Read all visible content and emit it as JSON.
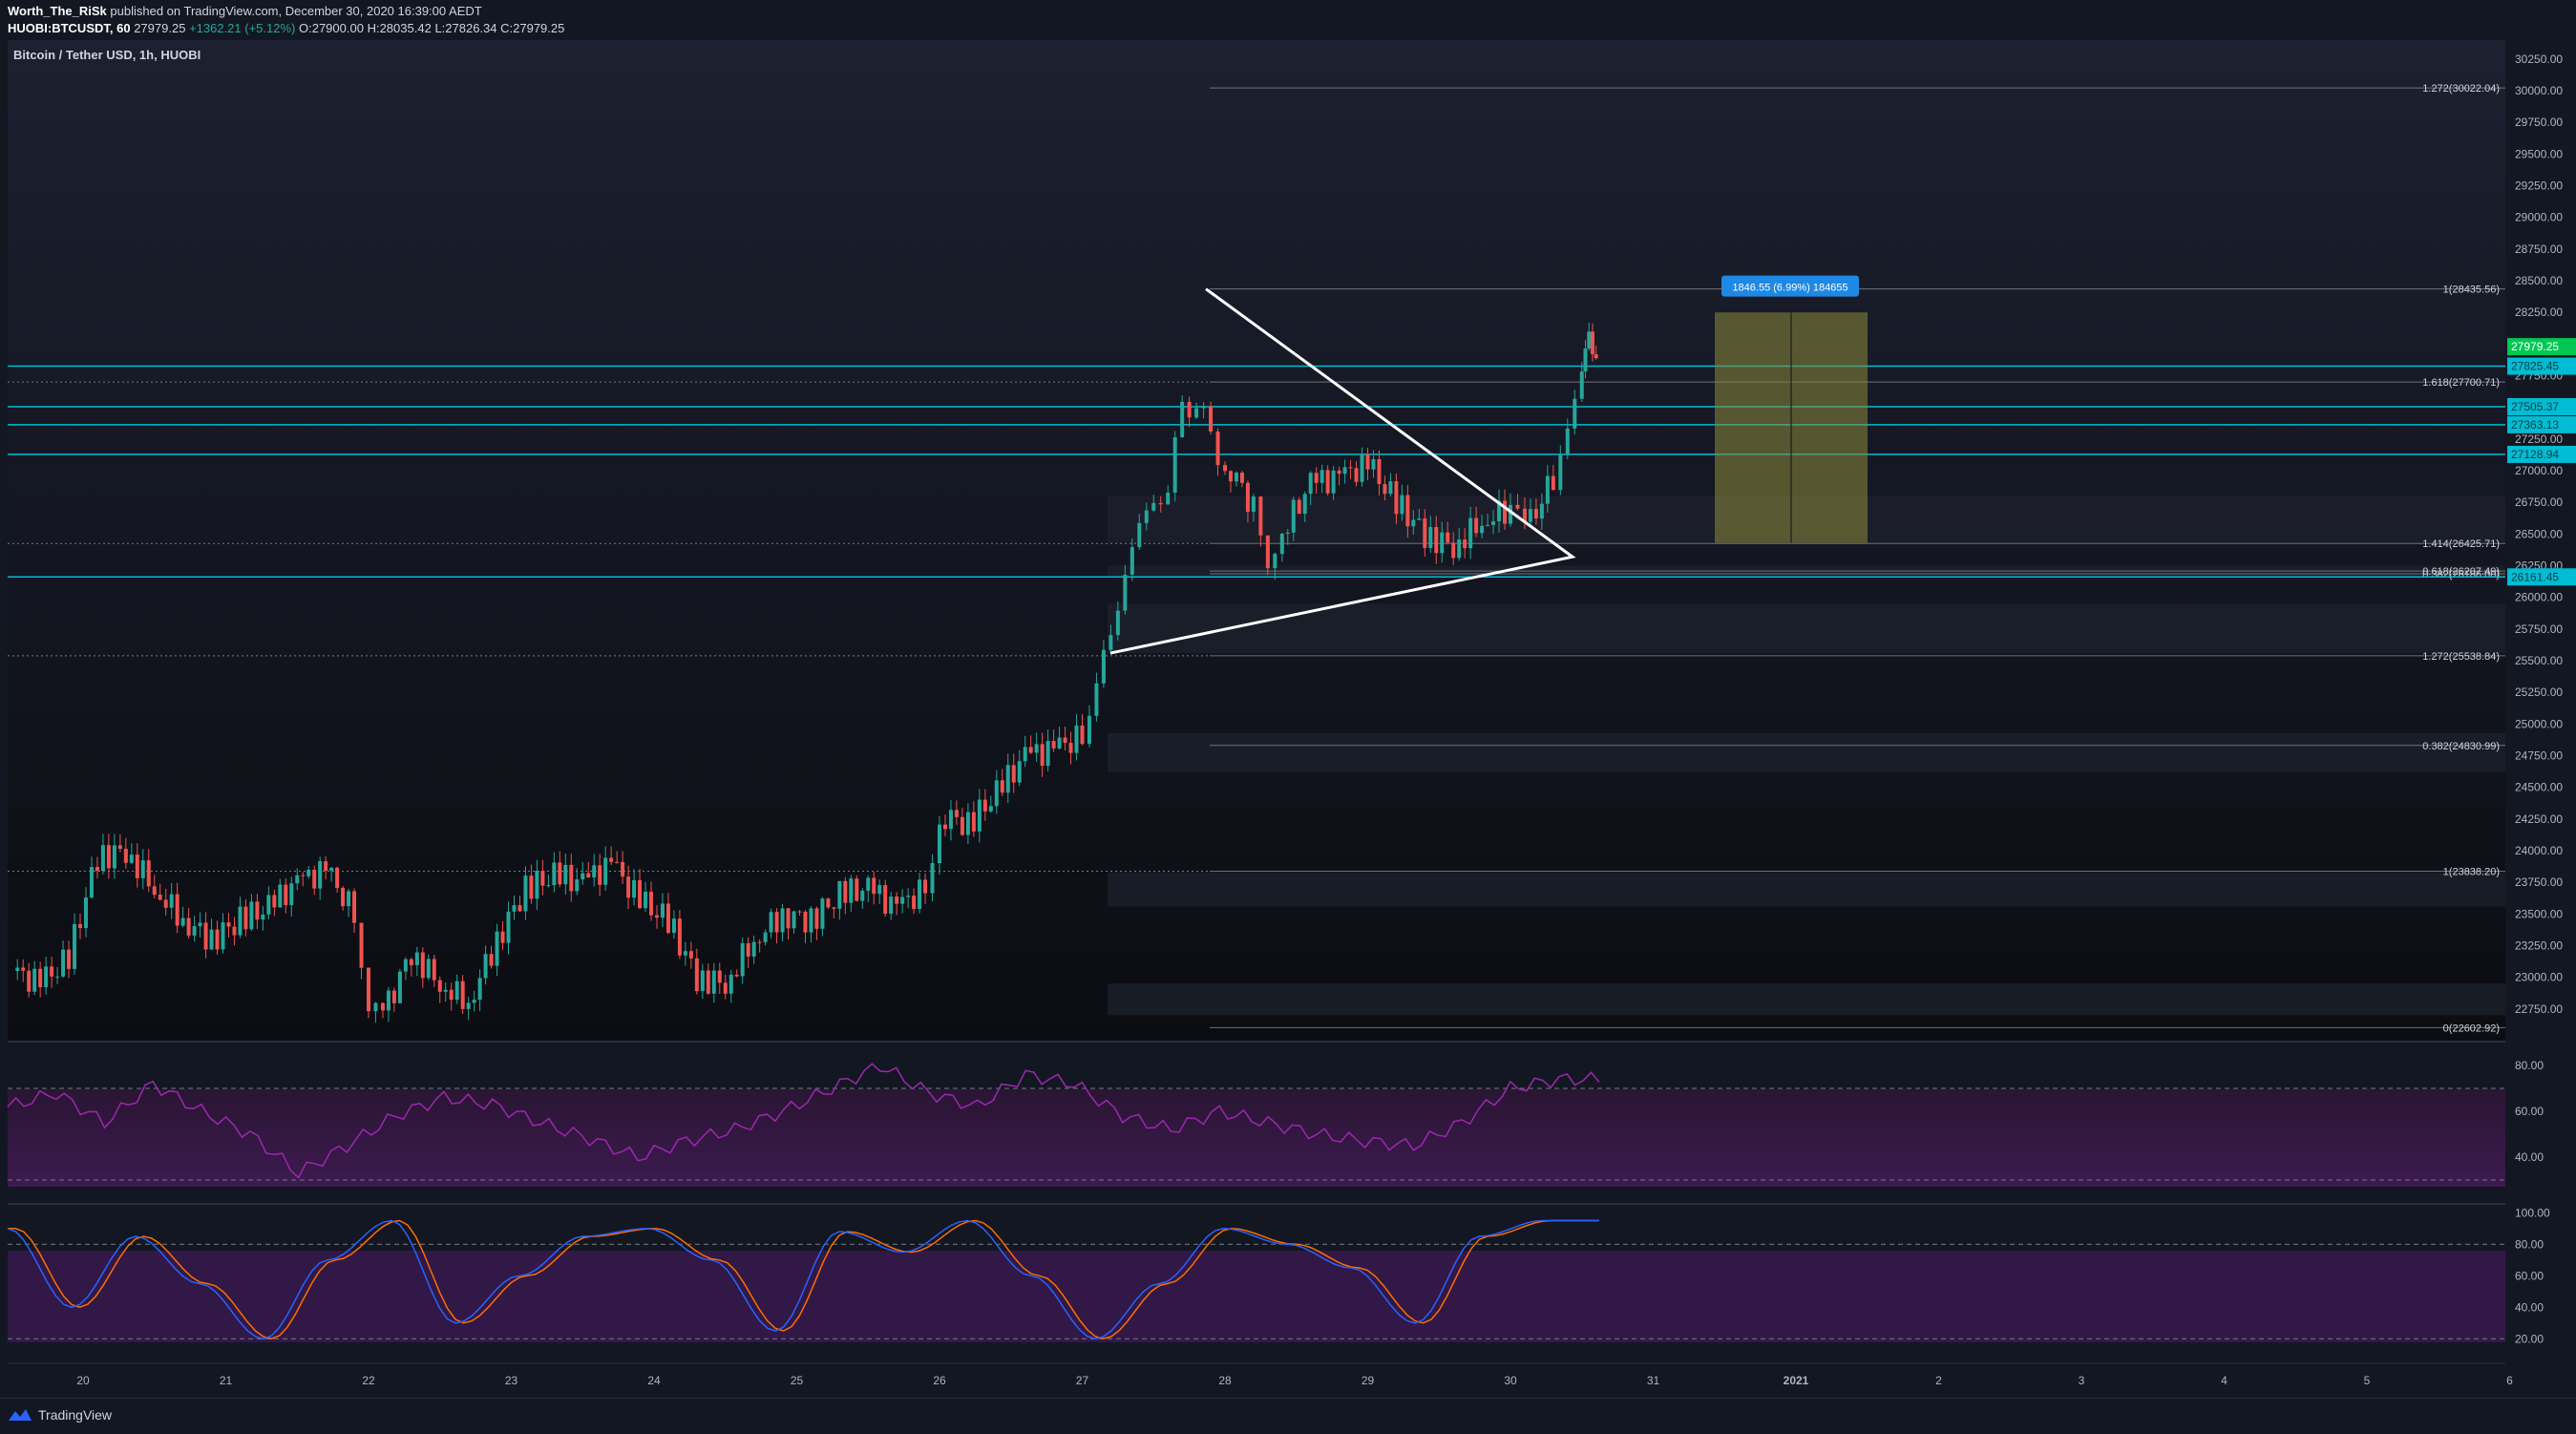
{
  "header": {
    "author": "Worth_The_RiSk",
    "published": "published on TradingView.com, December 30, 2020 16:39:00 AEDT",
    "symbol": "HUOBI:BTCUSDT, 60",
    "last": "27979.25",
    "change": "+1362.21 (+5.12%)",
    "ohlc_o": "O:27900.00",
    "ohlc_h": "H:28035.42",
    "ohlc_l": "L:27826.34",
    "ohlc_c": "C:27979.25"
  },
  "chart_title": "Bitcoin / Tether USD, 1h, HUOBI",
  "colors": {
    "background": "#131722",
    "bullish": "#26a69a",
    "bearish": "#ef5350",
    "cyan_level": "#00bcd4",
    "rsi_line": "#9c27b0",
    "stoch_k": "#2962ff",
    "stoch_d": "#ff6d00",
    "price_badge": "#1e88e5",
    "last_price": "#00c853"
  },
  "chart_data": {
    "type": "candlestick",
    "title": "Bitcoin / Tether USD, 1h, HUOBI",
    "ylim": [
      22500,
      30400
    ],
    "y_ticks": [
      "30250.00",
      "30000.00",
      "29750.00",
      "29500.00",
      "29250.00",
      "29000.00",
      "28750.00",
      "28500.00",
      "28250.00",
      "28000.00",
      "27750.00",
      "27500.00",
      "27250.00",
      "27000.00",
      "26750.00",
      "26500.00",
      "26250.00",
      "26000.00",
      "25750.00",
      "25500.00",
      "25250.00",
      "25000.00",
      "24750.00",
      "24500.00",
      "24250.00",
      "24000.00",
      "23750.00",
      "23500.00",
      "23250.00",
      "23000.00",
      "22750.00"
    ],
    "y_tick_values": [
      30250,
      30000,
      29750,
      29500,
      29250,
      29000,
      28750,
      28500,
      28250,
      28000,
      27750,
      27500,
      27250,
      27000,
      26750,
      26500,
      26250,
      26000,
      25750,
      25500,
      25250,
      25000,
      24750,
      24500,
      24250,
      24000,
      23750,
      23500,
      23250,
      23000,
      22750
    ],
    "x_ticks": [
      "20",
      "21",
      "22",
      "23",
      "24",
      "25",
      "26",
      "27",
      "28",
      "29",
      "30",
      "31",
      "2021",
      "2",
      "3",
      "4",
      "5",
      "6"
    ],
    "candles_close_path": [
      [
        19.5,
        23050
      ],
      [
        19.7,
        22950
      ],
      [
        19.9,
        23150
      ],
      [
        20.1,
        23950
      ],
      [
        20.3,
        24000
      ],
      [
        20.5,
        23700
      ],
      [
        20.7,
        23450
      ],
      [
        20.9,
        23300
      ],
      [
        21.1,
        23450
      ],
      [
        21.3,
        23550
      ],
      [
        21.5,
        23750
      ],
      [
        21.7,
        23850
      ],
      [
        21.9,
        23500
      ],
      [
        22.0,
        22800
      ],
      [
        22.1,
        22700
      ],
      [
        22.3,
        23200
      ],
      [
        22.5,
        22950
      ],
      [
        22.7,
        22800
      ],
      [
        22.9,
        23300
      ],
      [
        23.1,
        23700
      ],
      [
        23.3,
        23800
      ],
      [
        23.5,
        23750
      ],
      [
        23.7,
        23900
      ],
      [
        23.9,
        23600
      ],
      [
        24.1,
        23450
      ],
      [
        24.3,
        23000
      ],
      [
        24.5,
        22950
      ],
      [
        24.7,
        23300
      ],
      [
        24.9,
        23500
      ],
      [
        25.1,
        23450
      ],
      [
        25.3,
        23650
      ],
      [
        25.5,
        23700
      ],
      [
        25.7,
        23550
      ],
      [
        25.9,
        23700
      ],
      [
        26.0,
        24300
      ],
      [
        26.2,
        24200
      ],
      [
        26.4,
        24450
      ],
      [
        26.6,
        24750
      ],
      [
        26.8,
        24800
      ],
      [
        27.0,
        24900
      ],
      [
        27.1,
        25400
      ],
      [
        27.2,
        25650
      ],
      [
        27.3,
        26200
      ],
      [
        27.4,
        26600
      ],
      [
        27.5,
        26700
      ],
      [
        27.6,
        26900
      ],
      [
        27.7,
        27450
      ],
      [
        27.8,
        27600
      ],
      [
        27.9,
        27200
      ],
      [
        28.0,
        27100
      ],
      [
        28.2,
        26700
      ],
      [
        28.3,
        26200
      ],
      [
        28.4,
        26500
      ],
      [
        28.6,
        26900
      ],
      [
        28.8,
        26950
      ],
      [
        29.0,
        27050
      ],
      [
        29.2,
        26750
      ],
      [
        29.4,
        26500
      ],
      [
        29.6,
        26400
      ],
      [
        29.8,
        26600
      ],
      [
        30.0,
        26700
      ],
      [
        30.1,
        26500
      ],
      [
        30.3,
        26950
      ],
      [
        30.4,
        27350
      ],
      [
        30.5,
        27800
      ],
      [
        30.55,
        28050
      ],
      [
        30.6,
        27979
      ]
    ],
    "horizontal_levels": [
      {
        "price": 27825.45,
        "label": "27825.45"
      },
      {
        "price": 27505.37,
        "label": "27505.37"
      },
      {
        "price": 27363.13,
        "label": "27363.13"
      },
      {
        "price": 27128.94,
        "label": "27128.94"
      },
      {
        "price": 26161.45,
        "label": "26161.45"
      }
    ],
    "last_price": {
      "price": 27979.25,
      "label": "27979.25"
    },
    "fib_levels": [
      {
        "price": 30022.04,
        "label": "1.272(30022.04)"
      },
      {
        "price": 28435.56,
        "label": "1(28435.56)"
      },
      {
        "price": 27700.71,
        "label": "1.618(27700.71)"
      },
      {
        "price": 26425.71,
        "label": "1.414(26425.71)"
      },
      {
        "price": 26207.49,
        "label": "0.618(26207.49)"
      },
      {
        "price": 26186.0,
        "label": "0.382(26186.00)"
      },
      {
        "price": 25538.84,
        "label": "1.272(25538.84)"
      },
      {
        "price": 24830.99,
        "label": "0.382(24830.99)"
      },
      {
        "price": 23838.2,
        "label": "1(23838.20)"
      },
      {
        "price": 22602.92,
        "label": "0(22602.92)"
      }
    ],
    "measure_label": "1846.55 (6.99%) 184655",
    "rsi": {
      "ticks": [
        "80.00",
        "60.00",
        "40.00"
      ],
      "values": [
        62,
        68,
        55,
        72,
        60,
        50,
        33,
        45,
        58,
        66,
        63,
        55,
        48,
        40,
        47,
        52,
        60,
        70,
        80,
        68,
        62,
        76,
        72,
        58,
        52,
        60,
        55,
        50,
        47,
        45,
        55,
        70,
        74
      ]
    },
    "stoch": {
      "ticks": [
        "100.00",
        "80.00",
        "60.00",
        "40.00",
        "20.00"
      ],
      "values": [
        90,
        40,
        85,
        55,
        20,
        70,
        95,
        30,
        60,
        85,
        90,
        70,
        25,
        88,
        75,
        95,
        60,
        20,
        55,
        90,
        80,
        65,
        30,
        85,
        95
      ]
    }
  },
  "footer": {
    "brand": "TradingView"
  }
}
